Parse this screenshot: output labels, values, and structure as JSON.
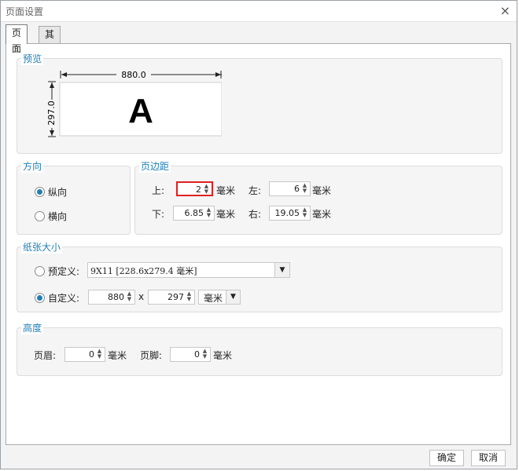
{
  "window": {
    "title": "页面设置",
    "close_glyph": "×"
  },
  "tabs": [
    {
      "label": "页面"
    },
    {
      "label": "其他"
    }
  ],
  "preview": {
    "legend": "预览",
    "width_label": "880.0",
    "height_label": "297.0",
    "paper_letter": "A"
  },
  "orientation": {
    "legend": "方向",
    "portrait": "纵向",
    "landscape": "横向",
    "selected": "portrait"
  },
  "margins": {
    "legend": "页边距",
    "top": {
      "label": "上:",
      "value": "2",
      "unit": "毫米"
    },
    "left": {
      "label": "左:",
      "value": "6",
      "unit": "毫米"
    },
    "bottom": {
      "label": "下:",
      "value": "6.85",
      "unit": "毫米"
    },
    "right": {
      "label": "右:",
      "value": "19.05",
      "unit": "毫米"
    }
  },
  "paper": {
    "legend": "纸张大小",
    "predefined_label": "预定义:",
    "predefined_value": "9X11 [228.6x279.4 毫米]",
    "custom_label": "自定义:",
    "custom_width": "880",
    "custom_x": "x",
    "custom_height": "297",
    "custom_unit": "毫米",
    "selected": "custom"
  },
  "height": {
    "legend": "高度",
    "header_label": "页眉:",
    "header_value": "0",
    "header_unit": "毫米",
    "footer_label": "页脚:",
    "footer_value": "0",
    "footer_unit": "毫米"
  },
  "buttons": {
    "ok": "确定",
    "cancel": "取消"
  },
  "colors": {
    "accent": "#1e7fb8",
    "highlight": "#e02020"
  }
}
